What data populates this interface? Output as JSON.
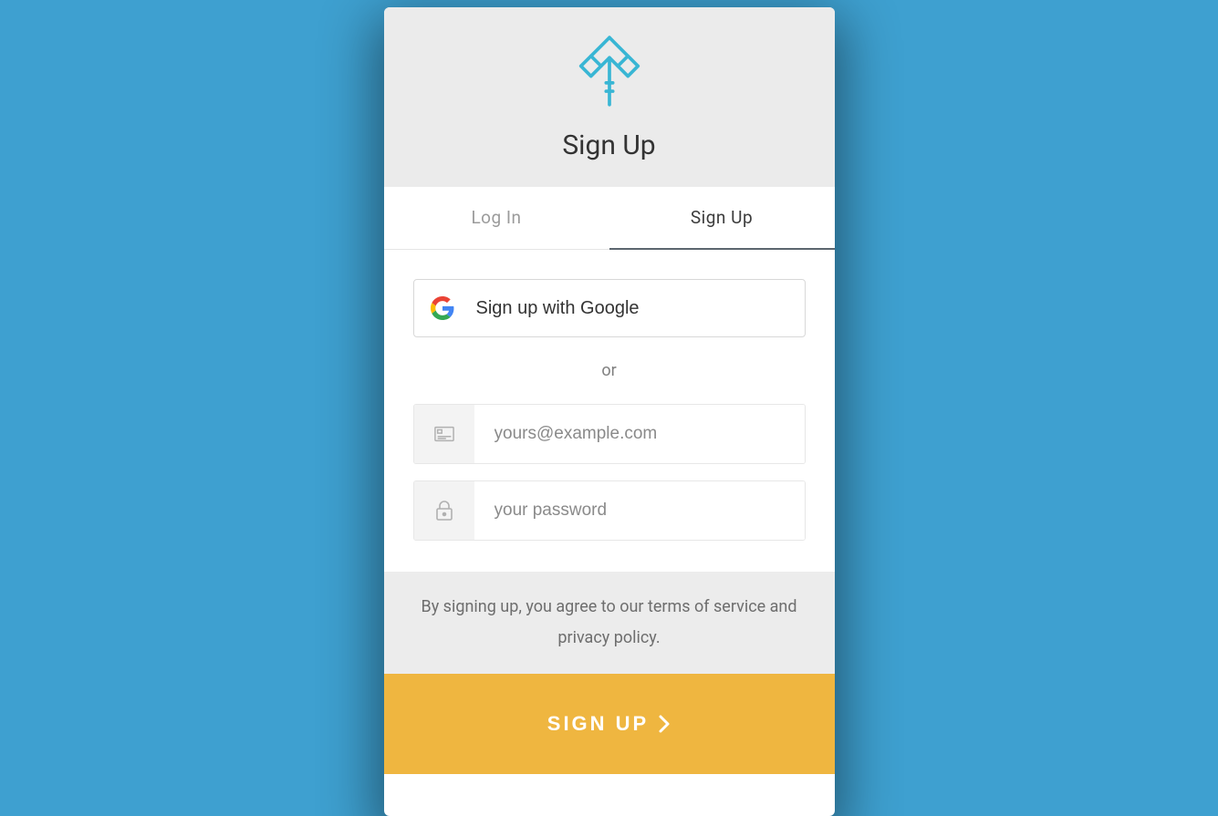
{
  "header": {
    "title": "Sign Up"
  },
  "tabs": {
    "login": "Log In",
    "signup": "Sign Up"
  },
  "social": {
    "google_label": "Sign up with Google"
  },
  "separator": "or",
  "fields": {
    "email_placeholder": "yours@example.com",
    "password_placeholder": "your password"
  },
  "terms": "By signing up, you agree to our terms of service and privacy policy.",
  "submit_label": "SIGN UP",
  "colors": {
    "background": "#3ea0d0",
    "accent": "#efb640",
    "logo": "#39b6d4"
  }
}
